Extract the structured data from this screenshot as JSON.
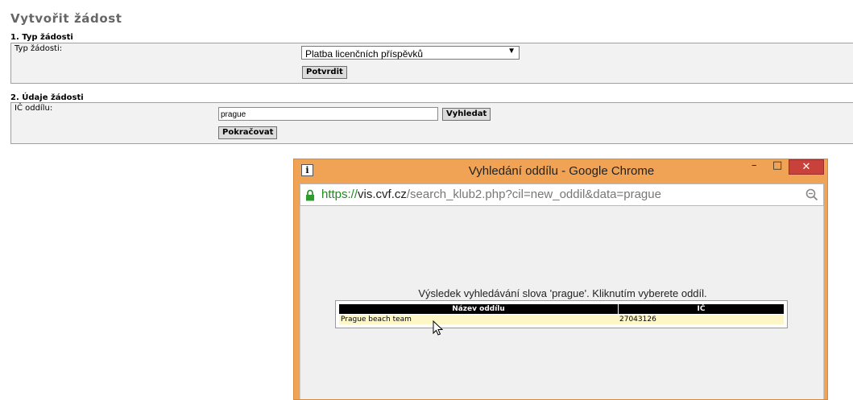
{
  "page": {
    "title": "Vytvořit žádost"
  },
  "section1": {
    "heading": "1. Typ žádosti",
    "field_label": "Typ žádosti:",
    "select_value": "Platba licenčních příspěvků",
    "confirm_button": "Potvrdit"
  },
  "section2": {
    "heading": "2. Údaje žádosti",
    "field_label": "IČ oddílu:",
    "input_value": "prague",
    "search_button": "Vyhledat",
    "continue_button": "Pokračovat"
  },
  "popup": {
    "window_title": "Vyhledání oddílu - Google Chrome",
    "url_scheme": "https://",
    "url_host": "vis.cvf.cz",
    "url_path": "/search_klub2.php?cil=new_oddil&data=prague",
    "minimize_glyph": "–",
    "maximize_glyph": "□",
    "close_glyph": "✕",
    "info_glyph": "i",
    "result_caption": "Výsledek vyhledávání slova 'prague'. Kliknutím vyberete oddíl.",
    "table": {
      "headers": [
        "Název oddílu",
        "IČ"
      ],
      "rows": [
        {
          "name": "Prague beach team",
          "ic": "27043126"
        }
      ]
    }
  },
  "colors": {
    "window_frame": "#f0a355",
    "close_button": "#c8413b",
    "url_scheme": "#1e8a1e",
    "table_header": "#000000",
    "table_row": "#fdf7c8",
    "fieldset_bg": "#f2f2f2"
  },
  "icons": [
    "info-icon",
    "lock-icon",
    "zoom-icon",
    "minimize-icon",
    "maximize-icon",
    "close-icon",
    "mouse-cursor-icon",
    "dropdown-arrow-icon"
  ]
}
